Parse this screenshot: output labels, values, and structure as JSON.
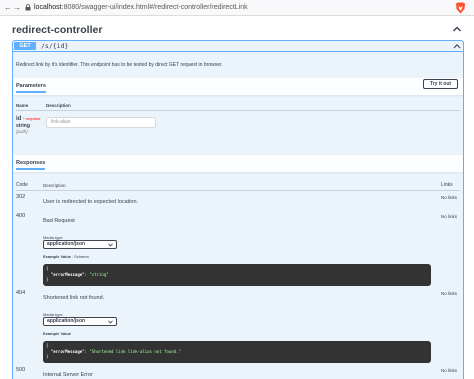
{
  "browser": {
    "url_host": "localhost",
    "url_rest": ":8080/swagger-ui/index.html#/redirect-controller/redirectLink"
  },
  "tag": {
    "title": "redirect-controller"
  },
  "operation": {
    "method": "GET",
    "path": "/s/{id}",
    "description": "Redirect link by it's identifier. This endpoint has to be tested by direct GET request in browser."
  },
  "parameters": {
    "section_title": "Parameters",
    "try_it_out_label": "Try it out",
    "columns": {
      "name": "Name",
      "description": "Description"
    },
    "items": [
      {
        "name": "id",
        "required": "* required",
        "type": "string",
        "in": "(path)",
        "placeholder": "link-alias"
      }
    ]
  },
  "responses": {
    "section_title": "Responses",
    "columns": {
      "code": "Code",
      "description": "Description",
      "links": "Links"
    },
    "items": [
      {
        "code": "302",
        "description": "User is redirected to expected location.",
        "links": "No links"
      },
      {
        "code": "400",
        "description": "Bad Request",
        "links": "No links",
        "media_type_label": "Media type",
        "media_type": "application/json",
        "example_tab": "Example Value",
        "schema_tab": "Schema",
        "example_key": "\"errorMessage\"",
        "example_value": "\"string\""
      },
      {
        "code": "404",
        "description": "Shortened link not found.",
        "links": "No links",
        "media_type_label": "Media type",
        "media_type": "application/json",
        "example_tab": "Example Value",
        "example_key": "\"errorMessage\"",
        "example_value": "\"Shortened link link-alias not found.\""
      },
      {
        "code": "500",
        "description": "Internal Server Error",
        "links": "No links"
      }
    ]
  },
  "icons": {
    "lock": "lock-icon",
    "brave": "brave-lion-icon",
    "collapse": "chevron-up-icon",
    "caret": "chevron-down-icon"
  },
  "colors": {
    "get_accent": "#61affe",
    "get_background": "#ebf3fb",
    "code_background": "#333333",
    "required": "#ff0000",
    "string_value": "#a2fca2"
  }
}
